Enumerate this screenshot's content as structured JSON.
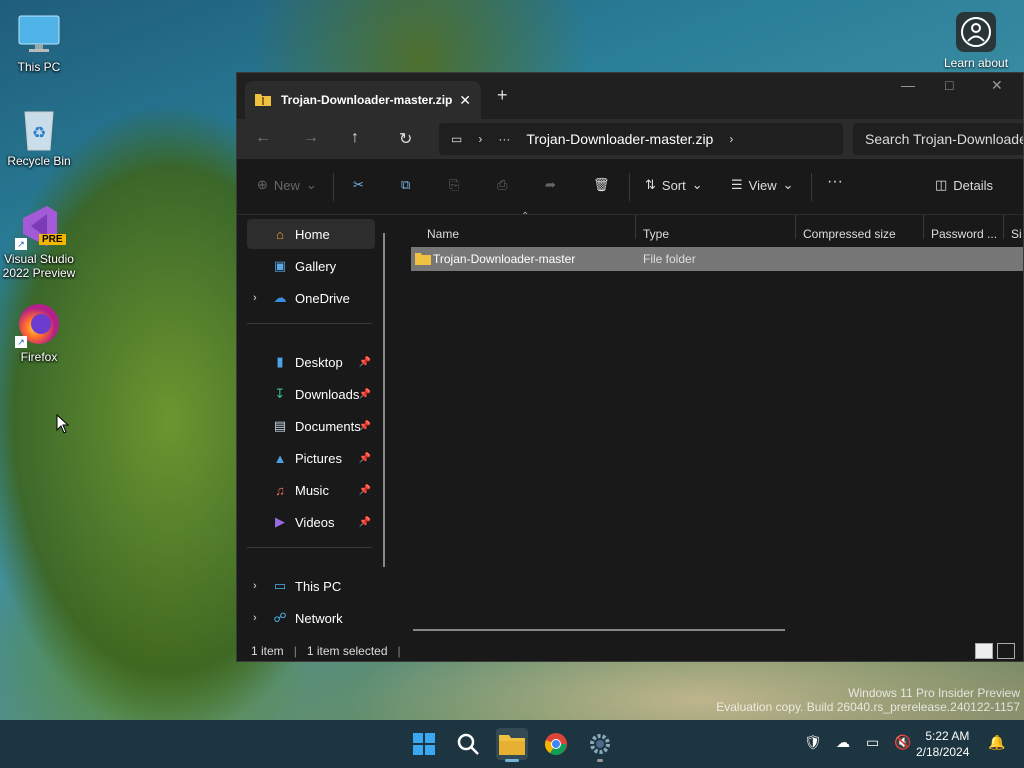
{
  "desktop": {
    "icons": [
      {
        "label": "This PC",
        "icon": "monitor-icon"
      },
      {
        "label": "Recycle Bin",
        "icon": "recycle-bin-icon"
      },
      {
        "label": "Visual Studio 2022 Preview",
        "icon": "visual-studio-icon",
        "badge": "PRE"
      },
      {
        "label": "Firefox",
        "icon": "firefox-icon"
      }
    ],
    "learn_about": "Learn about",
    "watermark": [
      "Windows 11 Pro Insider Preview",
      "Evaluation copy. Build 26040.rs_prerelease.240122-1157"
    ]
  },
  "explorer": {
    "tab_title": "Trojan-Downloader-master.zip",
    "address": {
      "crumb": "Trojan-Downloader-master.zip",
      "more": "···"
    },
    "search_placeholder": "Search Trojan-Downloader-master.zip",
    "toolbar": {
      "new_label": "New",
      "sort_label": "Sort",
      "view_label": "View",
      "more_label": "···",
      "details_label": "Details"
    },
    "nav": {
      "home": "Home",
      "gallery": "Gallery",
      "onedrive": "OneDrive",
      "quick": [
        {
          "label": "Desktop",
          "icon": "desktop-folder-icon"
        },
        {
          "label": "Downloads",
          "icon": "downloads-icon"
        },
        {
          "label": "Documents",
          "icon": "documents-icon"
        },
        {
          "label": "Pictures",
          "icon": "pictures-icon"
        },
        {
          "label": "Music",
          "icon": "music-icon"
        },
        {
          "label": "Videos",
          "icon": "videos-icon"
        }
      ],
      "this_pc": "This PC",
      "network": "Network"
    },
    "columns": [
      "Name",
      "Type",
      "Compressed size",
      "Password ...",
      "Si"
    ],
    "rows": [
      {
        "name": "Trojan-Downloader-master",
        "type": "File folder"
      }
    ],
    "status": {
      "count": "1 item",
      "selected": "1 item selected"
    }
  },
  "taskbar": {
    "time": "5:22 AM",
    "date": "2/18/2024"
  }
}
